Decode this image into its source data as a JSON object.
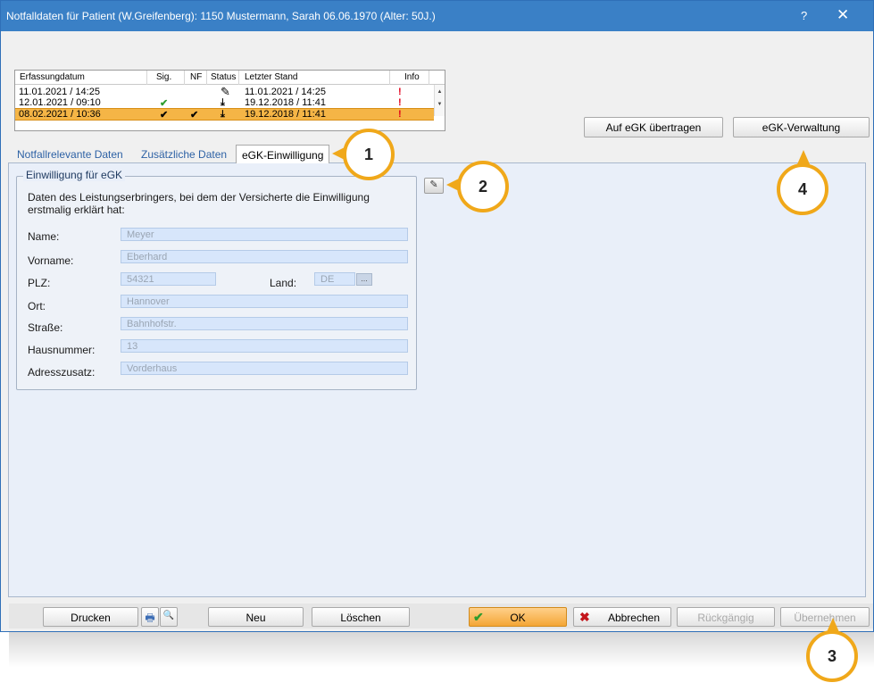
{
  "window": {
    "title": "Notfalldaten für Patient (W.Greifenberg): 1150  Mustermann, Sarah 06.06.1970  (Alter: 50J.)",
    "help_glyph": "?",
    "close_glyph": "✕"
  },
  "table": {
    "headers": [
      "Erfassungdatum",
      "Sig.",
      "NF",
      "Status",
      "Letzter Stand",
      "Info"
    ],
    "rows": [
      {
        "date": "11.01.2021 / 14:25",
        "sig": "",
        "nf": "",
        "status": "✎",
        "last": "11.01.2021 / 14:25",
        "info": "!"
      },
      {
        "date": "12.01.2021 / 09:10",
        "sig": "✔",
        "nf": "",
        "status": "⤓",
        "last": "19.12.2018 / 11:41",
        "info": "!"
      },
      {
        "date": "08.02.2021 / 10:36",
        "sig": "✔",
        "nf": "✔",
        "status": "⤓",
        "last": "19.12.2018 / 11:41",
        "info": "!"
      }
    ],
    "scroll_up": "▲",
    "scroll_down": "▼"
  },
  "buttons": {
    "auf_egk": "Auf eGK übertragen",
    "egk_verwaltung": "eGK-Verwaltung",
    "drucken": "Drucken",
    "neu": "Neu",
    "loeschen": "Löschen",
    "ok": "OK",
    "abbrechen": "Abbrechen",
    "rueckgaengig": "Rückgängig",
    "uebernehmen": "Übernehmen",
    "ok_icon": "✔",
    "cancel_icon": "✖",
    "printer_icon": "🖶",
    "preview_icon": "🔍",
    "edit_icon": "✎",
    "land_dropdown": "..."
  },
  "tabs": [
    "Notfallrelevante Daten",
    "Zusätzliche Daten",
    "eGK-Einwilligung"
  ],
  "group": {
    "title": "Einwilligung für eGK",
    "description": "Daten des Leistungserbringers, bei dem der Versicherte die Einwilligung erstmalig erklärt hat:",
    "fields": {
      "name": {
        "label": "Name:",
        "value": "Meyer"
      },
      "vorname": {
        "label": "Vorname:",
        "value": "Eberhard"
      },
      "plz": {
        "label": "PLZ:",
        "value": "54321"
      },
      "land": {
        "label": "Land:",
        "value": "DE"
      },
      "ort": {
        "label": "Ort:",
        "value": "Hannover"
      },
      "strasse": {
        "label": "Straße:",
        "value": "Bahnhofstr."
      },
      "hausnummer": {
        "label": "Hausnummer:",
        "value": "13"
      },
      "adresszusatz": {
        "label": "Adresszusatz:",
        "value": "Vorderhaus"
      }
    }
  },
  "callouts": [
    "1",
    "2",
    "3",
    "4"
  ],
  "colors": {
    "accent": "#f0a81a",
    "titlebar": "#3a80c6",
    "selected_row": "#f5b546"
  }
}
